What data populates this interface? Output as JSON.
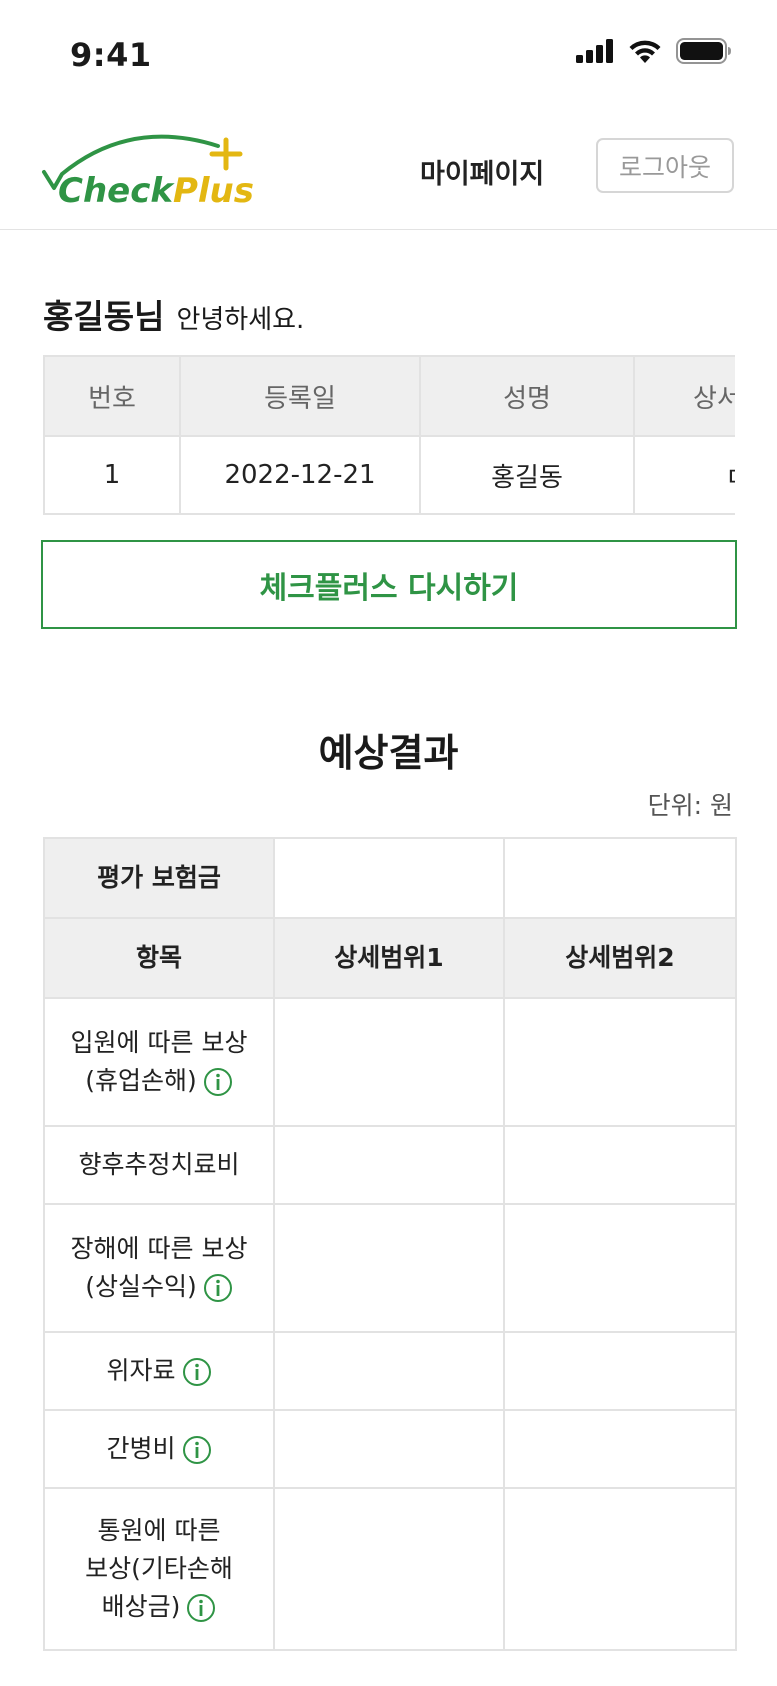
{
  "status_bar": {
    "time": "9:41"
  },
  "header": {
    "logo_text": "CheckPlus",
    "mypage_label": "마이페이지",
    "logout_label": "로그아웃"
  },
  "greeting": {
    "name": "홍길동님",
    "text": "안녕하세요."
  },
  "history_table": {
    "columns": [
      "번호",
      "등록일",
      "성명",
      "상서"
    ],
    "rows": [
      {
        "no": "1",
        "date": "2022-12-21",
        "name": "홍길동",
        "detail": "ㄷ"
      }
    ]
  },
  "retry_button_label": "체크플러스 다시하기",
  "result": {
    "title": "예상결과",
    "unit": "단위: 원",
    "eval_label": "평가 보험금",
    "item_header": "항목",
    "range1_header": "상세범위1",
    "range2_header": "상세범위2",
    "items": [
      {
        "line1": "입원에 따른 보상",
        "line2": "(휴업손해)",
        "info": true
      },
      {
        "line1": "향후추정치료비",
        "line2": "",
        "info": false
      },
      {
        "line1": "장해에 따른 보상",
        "line2": "(상실수익)",
        "info": true
      },
      {
        "line1": "위자료",
        "line2": "",
        "info": true
      },
      {
        "line1": "간병비",
        "line2": "",
        "info": true
      },
      {
        "line1": "통원에 따른",
        "line2": "보상(기타손해",
        "line3": "배상금)",
        "info": true
      }
    ]
  },
  "colors": {
    "brand_green": "#2f9445",
    "brand_yellow": "#e3b712",
    "header_gray": "#efefef",
    "border": "#e2e2e2"
  },
  "icons": [
    "signal-icon",
    "wifi-icon",
    "battery-icon",
    "info-icon"
  ]
}
